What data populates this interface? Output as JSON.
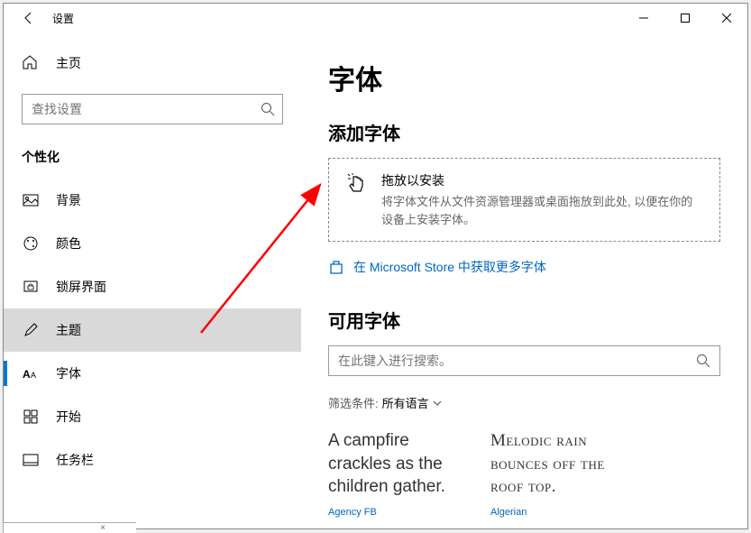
{
  "title": "设置",
  "home_label": "主页",
  "search_placeholder": "查找设置",
  "category": "个性化",
  "nav": [
    {
      "label": "背景"
    },
    {
      "label": "颜色"
    },
    {
      "label": "锁屏界面"
    },
    {
      "label": "主题"
    },
    {
      "label": "字体"
    },
    {
      "label": "开始"
    },
    {
      "label": "任务栏"
    }
  ],
  "page_heading": "字体",
  "add_section_title": "添加字体",
  "drop": {
    "title": "拖放以安装",
    "desc": "将字体文件从文件资源管理器或桌面拖放到此处, 以便在你的设备上安装字体。"
  },
  "store_link": "在 Microsoft Store 中获取更多字体",
  "available_title": "可用字体",
  "font_search_placeholder": "在此键入进行搜索。",
  "filter_label": "筛选条件:",
  "filter_value": "所有语言",
  "fonts": [
    {
      "preview": "A campfire crackles as the children gather.",
      "name": "Agency FB"
    },
    {
      "preview": "Melodic rain bounces off the roof top.",
      "name": "Algerian"
    }
  ]
}
